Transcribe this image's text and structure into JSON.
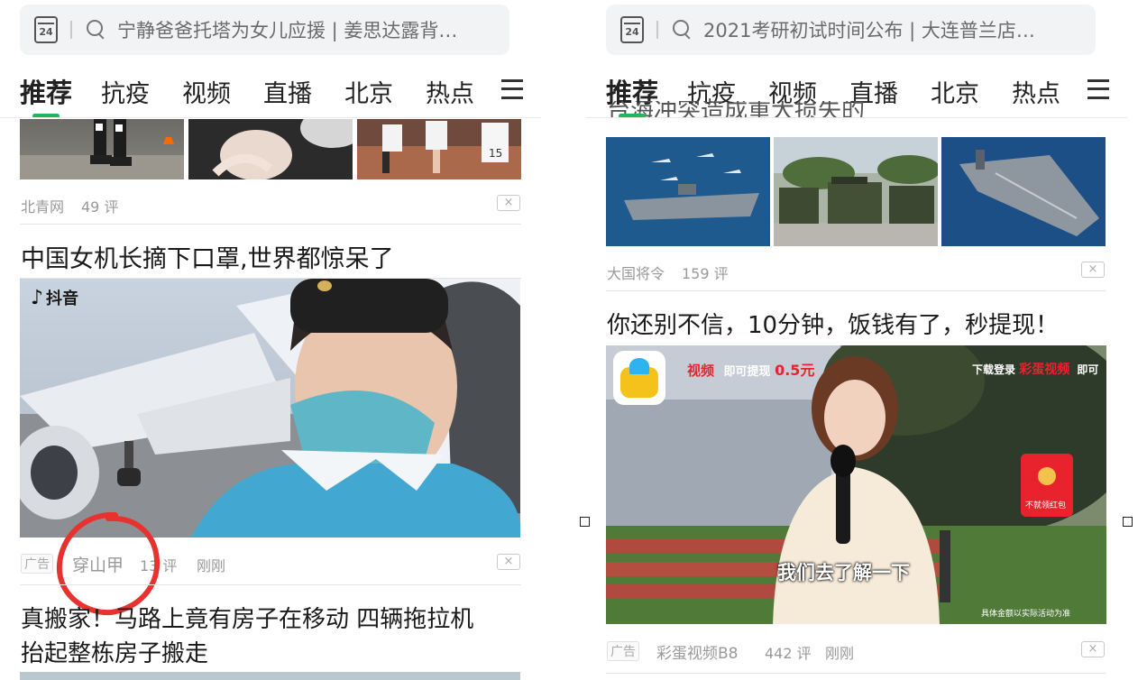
{
  "left": {
    "search": {
      "calendar_label": "24",
      "placeholder": "宁静爸爸托塔为女儿应援 | 姜思达露背…"
    },
    "tabs": [
      "推荐",
      "抗疫",
      "视频",
      "直播",
      "北京",
      "热点"
    ],
    "top_meta": {
      "source": "北青网",
      "comments": "49 评",
      "close": "×"
    },
    "article1": {
      "title": "中国女机长摘下口罩,世界都惊呆了",
      "watermark": "抖音",
      "ad": "广告",
      "source": "穿山甲",
      "comments": "13 评",
      "time": "刚刚",
      "close": "×"
    },
    "article2": {
      "title_line1": "真搬家！马路上竟有房子在移动 四辆拖拉机",
      "title_line2": "抬起整栋房子搬走"
    }
  },
  "right": {
    "search": {
      "calendar_label": "24",
      "placeholder": "2021考研初试时间公布 | 大连普兰店…"
    },
    "tabs": [
      "推荐",
      "抗疫",
      "视频",
      "直播",
      "北京",
      "热点"
    ],
    "partial_title": "台海冲突造成重大损失的",
    "top_meta": {
      "source": "大国将令",
      "comments": "159 评",
      "close": "×"
    },
    "article1": {
      "title": "你还别不信，10分钟，饭钱有了，秒提现！",
      "banner_left": "视频",
      "banner_left_sub": "即可提现",
      "banner_amount": "0.5元",
      "banner_right_pre": "下载登录",
      "banner_right_brand": "彩蛋视频",
      "banner_right_post": "即可",
      "red_packet": "不就领红包",
      "subtitle": "我们去了解一下",
      "disclaimer": "具体金额以实际活动为准",
      "ad": "广告",
      "source": "彩蛋视频B8",
      "comments": "442 评",
      "time": "刚刚",
      "close": "×"
    }
  },
  "colors": {
    "accent": "#22b55c",
    "annotation_circle": "#e8322f",
    "banner_red": "#e8232d"
  }
}
